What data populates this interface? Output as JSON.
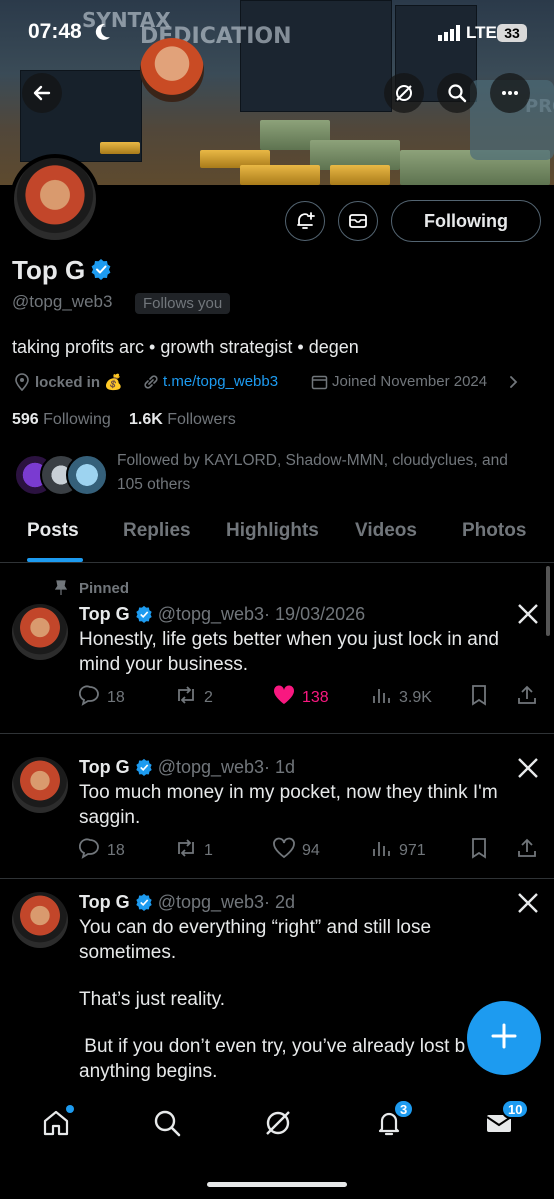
{
  "status_bar": {
    "time": "07:48",
    "network": "LTE",
    "battery": "33"
  },
  "profile": {
    "name": "Top G",
    "handle": "@topg_web3",
    "follows_you": "Follows you",
    "following_button": "Following",
    "bio": "taking profits arc • growth strategist • degen",
    "location": "locked in 💰",
    "link": "t.me/topg_webb3",
    "joined": "Joined November 2024",
    "following_count": "596",
    "following_label": "Following",
    "followers_count": "1.6K",
    "followers_label": "Followers",
    "followed_by": "Followed by KAYLORD, Shadow-MMN, cloudyclues, and 105 others"
  },
  "tabs": [
    "Posts",
    "Replies",
    "Highlights",
    "Videos",
    "Photos"
  ],
  "pinned_label": "Pinned",
  "tweets": [
    {
      "name": "Top G",
      "handle": "@topg_web3",
      "time": "· 19/03/2026",
      "text": "Honestly, life gets better when you just lock in and mind your business.",
      "replies": "18",
      "retweets": "2",
      "likes": "138",
      "views": "3.9K"
    },
    {
      "name": "Top G",
      "handle": "@topg_web3",
      "time": "· 1d",
      "text": "Too much money in my pocket, now they think I'm saggin.",
      "replies": "18",
      "retweets": "1",
      "likes": "94",
      "views": "971"
    },
    {
      "name": "Top G",
      "handle": "@topg_web3",
      "time": "· 2d",
      "text_lines": [
        "You can do everything “right” and still lose",
        "sometimes.",
        "That’s just reality.",
        " But if you don’t even try, you’ve already lost b",
        "anything begins."
      ]
    }
  ],
  "nav_badges": {
    "notifications": "3",
    "messages": "10"
  },
  "colors": {
    "accent": "#1d9bf0",
    "like": "#f91880",
    "background": "#000000"
  }
}
